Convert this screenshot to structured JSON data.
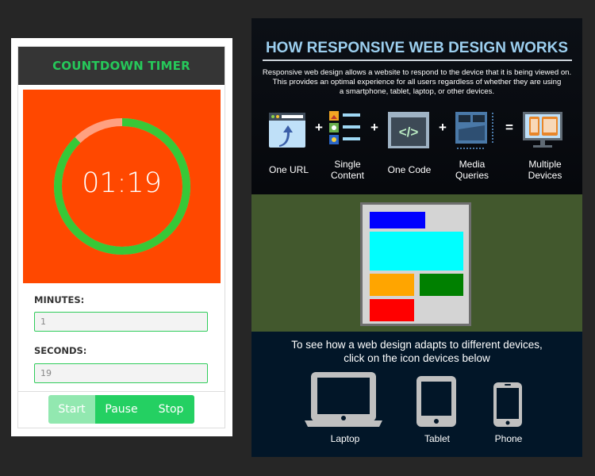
{
  "timer": {
    "title": "COUNTDOWN TIMER",
    "display": "01:19",
    "remaining_fraction": 0.878,
    "colors": {
      "face": "#ff4800",
      "ring_remaining": "#37c837",
      "ring_elapsed": "#ffa080",
      "title": "#26c85a",
      "button": "#24d062",
      "button_disabled": "#92e8b0"
    },
    "minutes_label": "MINUTES:",
    "minutes_value": "1",
    "seconds_label": "SECONDS:",
    "seconds_value": "19",
    "buttons": {
      "start": "Start",
      "pause": "Pause",
      "stop": "Stop"
    }
  },
  "infographic": {
    "title": "HOW RESPONSIVE WEB DESIGN WORKS",
    "description_lines": [
      "Responsive web design allows a website to respond to the device that it is being viewed on.",
      "This provides an optimal experience for all users regardless of whether they are using",
      "a smartphone, tablet, laptop, or other devices."
    ],
    "concepts": [
      {
        "icon": "browser-url-icon",
        "label": "One URL"
      },
      {
        "icon": "content-list-icon",
        "label": "Single Content"
      },
      {
        "icon": "code-icon",
        "label": "One Code"
      },
      {
        "icon": "media-queries-icon",
        "label": "Media Queries"
      },
      {
        "icon": "multiple-devices-icon",
        "label": "Multiple Devices"
      }
    ],
    "operators": [
      "+",
      "+",
      "+",
      "="
    ],
    "demo_blocks": [
      {
        "name": "header-block",
        "color": "#0000ff"
      },
      {
        "name": "banner-block",
        "color": "#00ffff"
      },
      {
        "name": "orange-block",
        "color": "#ffa500"
      },
      {
        "name": "green-block",
        "color": "#008000"
      },
      {
        "name": "red-block",
        "color": "#ff0000"
      }
    ],
    "devices_prompt_line1": "To see how a web design adapts to different devices,",
    "devices_prompt_line2": "click on the icon devices below",
    "devices": [
      {
        "name": "laptop",
        "label": "Laptop"
      },
      {
        "name": "tablet",
        "label": "Tablet"
      },
      {
        "name": "phone",
        "label": "Phone"
      }
    ]
  }
}
